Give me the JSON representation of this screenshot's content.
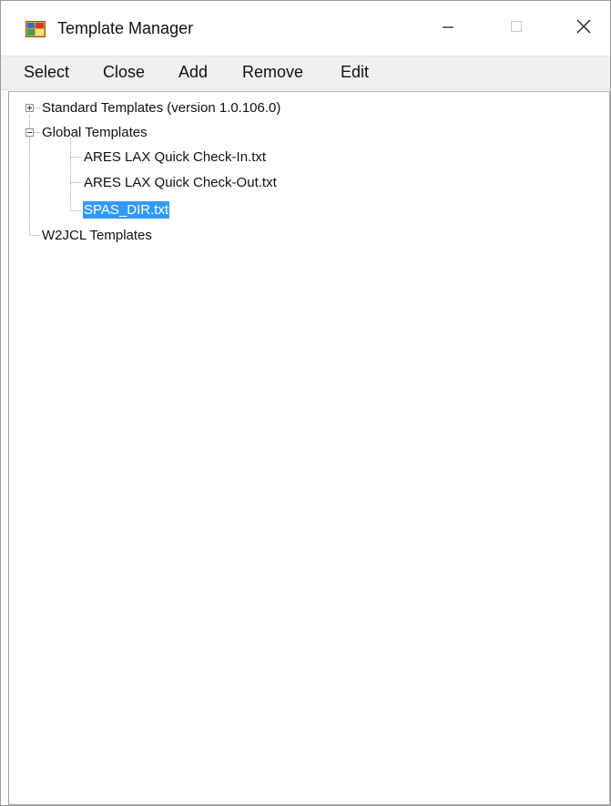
{
  "window": {
    "title": "Template Manager",
    "icon": "template-manager-app-icon"
  },
  "controls": {
    "minimize_icon": "minimize-icon",
    "maximize_icon": "maximize-icon",
    "close_icon": "close-icon"
  },
  "menu": {
    "items": [
      "Select",
      "Close",
      "Add",
      "Remove",
      "Edit"
    ]
  },
  "tree": {
    "nodes": [
      {
        "label": "Standard Templates (version 1.0.106.0)",
        "level": 0,
        "expanded": false,
        "has_children": true
      },
      {
        "label": "Global Templates",
        "level": 0,
        "expanded": true,
        "has_children": true
      },
      {
        "label": "ARES LAX Quick Check-In.txt",
        "level": 1
      },
      {
        "label": "ARES LAX Quick Check-Out.txt",
        "level": 1
      },
      {
        "label": "SPAS_DIR.txt",
        "level": 1,
        "selected": true
      },
      {
        "label": "W2JCL Templates",
        "level": 0,
        "has_children": false
      }
    ]
  },
  "colors": {
    "selection": "#3399ff",
    "menubar": "#f0f0f0"
  }
}
